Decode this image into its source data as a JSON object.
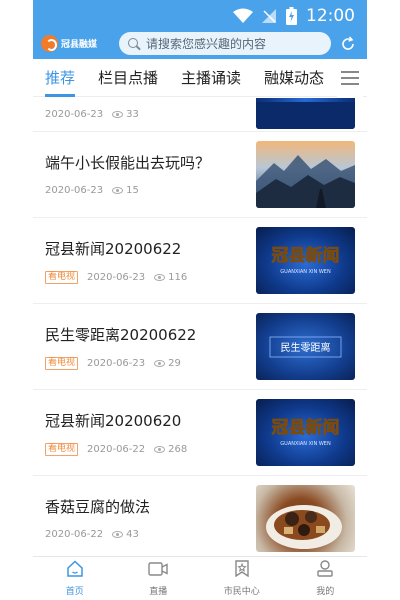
{
  "status_bar": {
    "time": "12:00",
    "icons": [
      "wifi-icon",
      "no-signal-icon",
      "battery-icon"
    ]
  },
  "header": {
    "logo_text": "冠县融媒",
    "search": {
      "placeholder": "请搜索您感兴趣的内容",
      "icon": "search-icon"
    },
    "refresh_icon": "refresh-icon"
  },
  "tabs": [
    {
      "label": "推荐",
      "active": true
    },
    {
      "label": "栏目点播",
      "active": false
    },
    {
      "label": "主播诵读",
      "active": false
    },
    {
      "label": "融媒动态",
      "active": false
    }
  ],
  "feed": {
    "items": [
      {
        "title": "",
        "tag": "",
        "date": "2020-06-23",
        "views": "33",
        "thumb": "news"
      },
      {
        "title": "端午小长假能出去玩吗？",
        "tag": "",
        "date": "2020-06-23",
        "views": "15",
        "thumb": "mountain"
      },
      {
        "title": "冠县新闻20200622",
        "tag": "看电视",
        "date": "2020-06-23",
        "views": "116",
        "thumb": "news"
      },
      {
        "title": "民生零距离20200622",
        "tag": "看电视",
        "date": "2020-06-23",
        "views": "29",
        "thumb": "minsheng"
      },
      {
        "title": "冠县新闻20200620",
        "tag": "看电视",
        "date": "2020-06-22",
        "views": "268",
        "thumb": "news"
      },
      {
        "title": "香菇豆腐的做法",
        "tag": "",
        "date": "2020-06-22",
        "views": "43",
        "thumb": "food"
      }
    ],
    "thumb_text": {
      "news_title": "冠县新闻",
      "news_pinyin": "GUANXIAN XIN WEN",
      "minsheng": "民生零距离"
    }
  },
  "bottom_nav": [
    {
      "label": "首页",
      "icon": "home-icon",
      "active": true
    },
    {
      "label": "直播",
      "icon": "live-tv-icon",
      "active": false
    },
    {
      "label": "市民中心",
      "icon": "citizen-center-icon",
      "active": false
    },
    {
      "label": "我的",
      "icon": "profile-icon",
      "active": false
    }
  ],
  "colors": {
    "brand": "#4aa3ea",
    "accent": "#3d95e2",
    "tag": "#f08b3a"
  }
}
